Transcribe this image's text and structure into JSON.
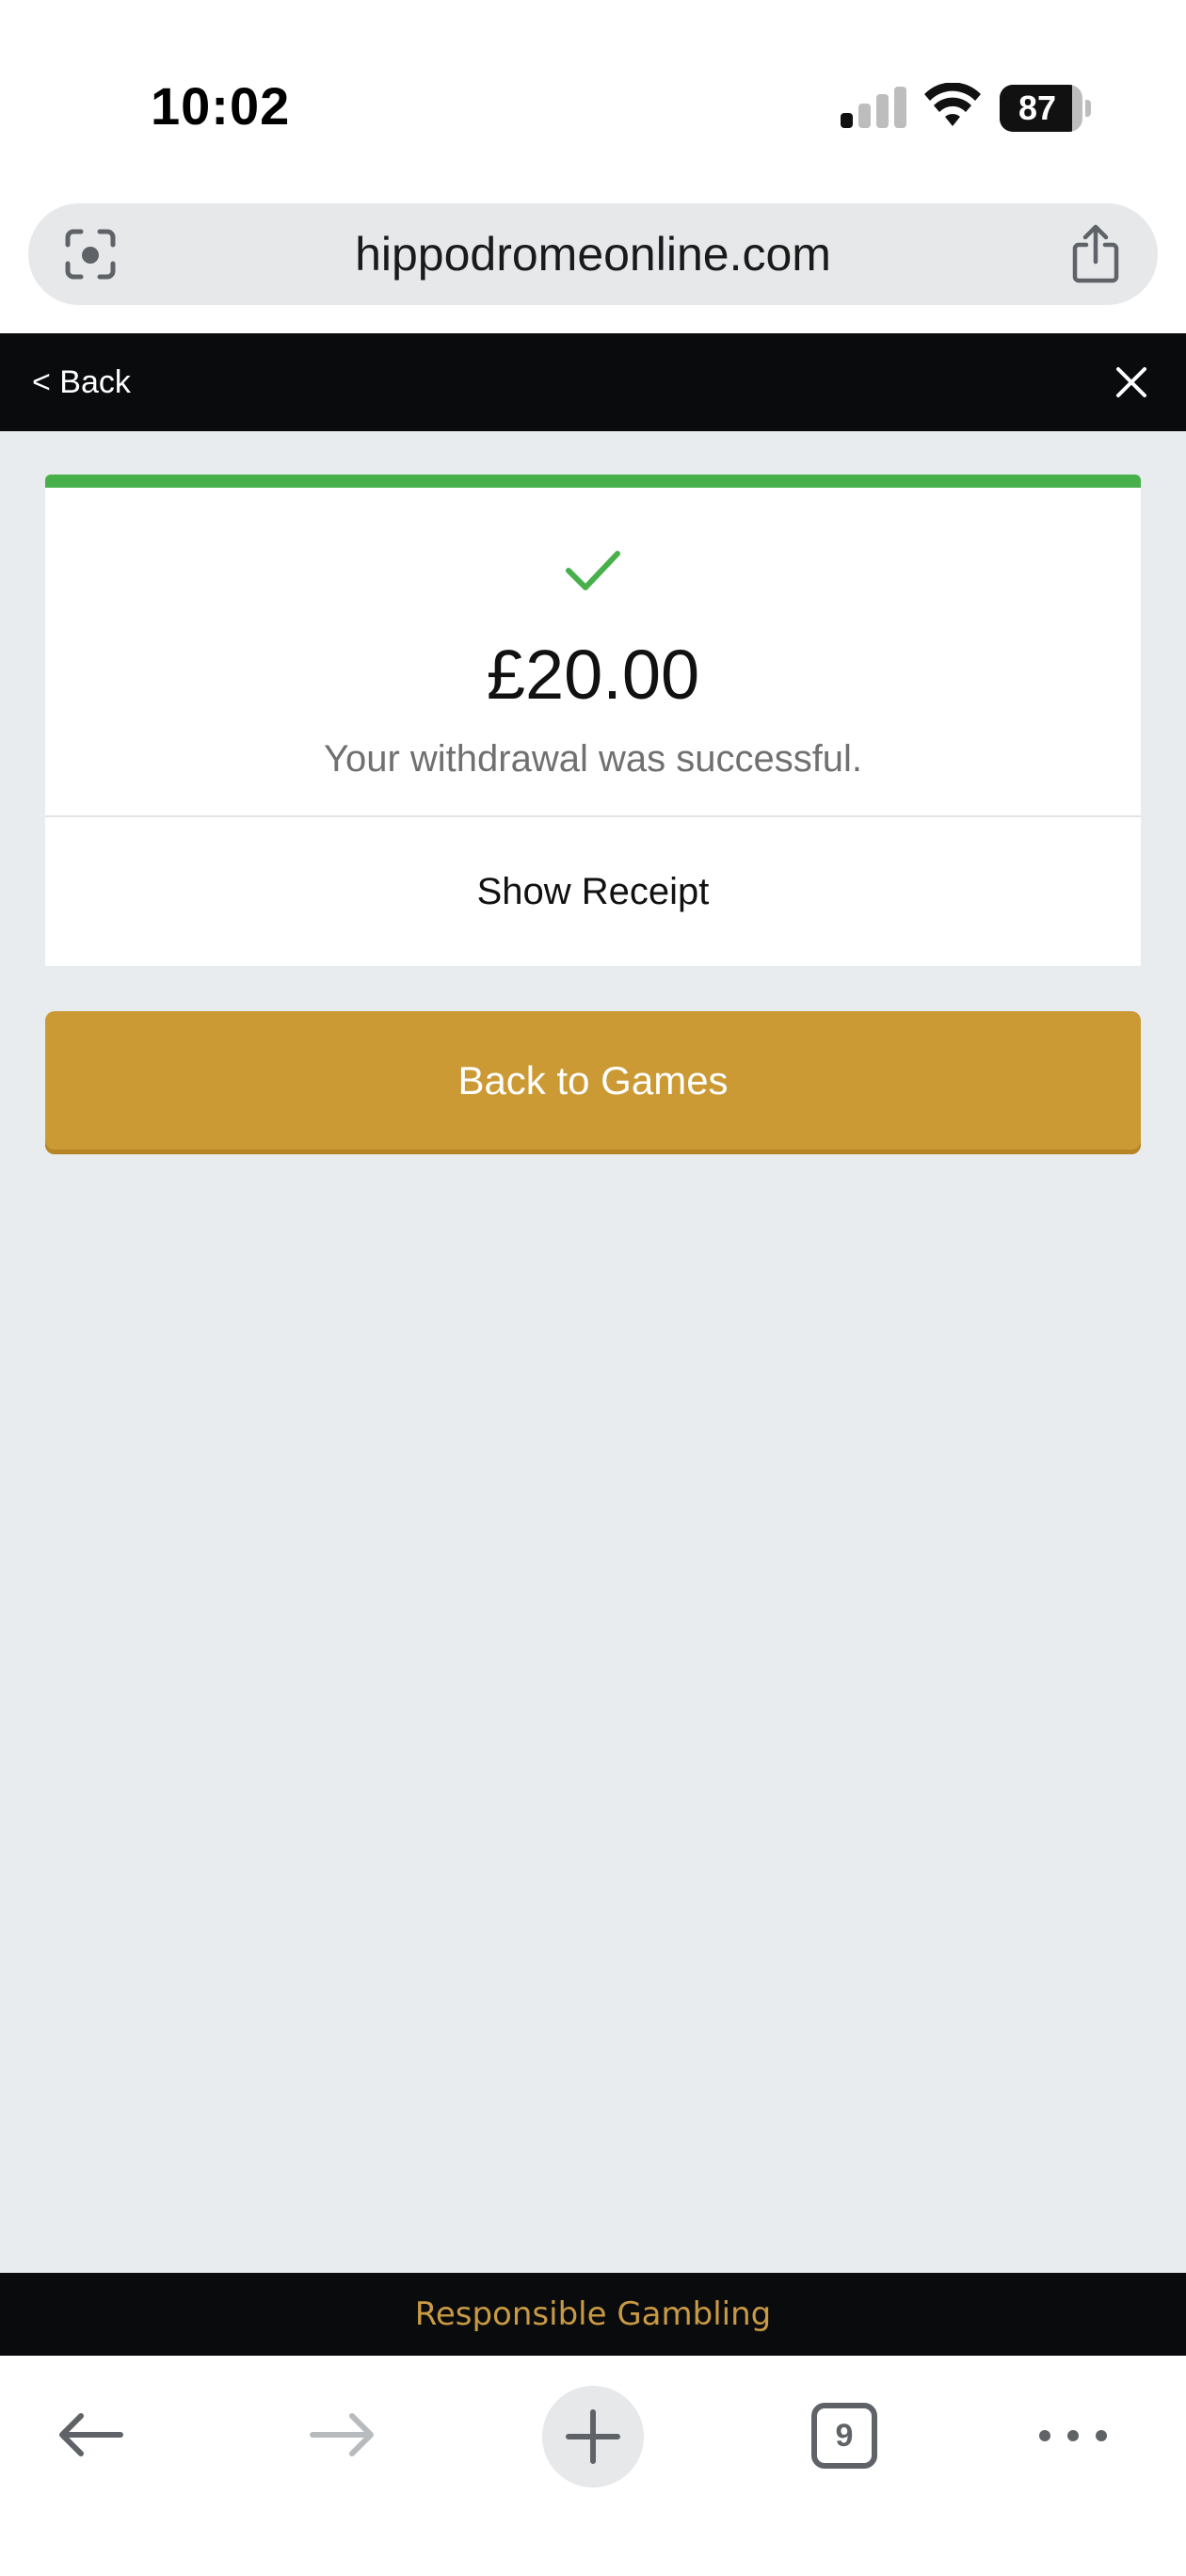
{
  "status_bar": {
    "time": "10:02",
    "battery": "87",
    "battery_level": 0.87
  },
  "browser": {
    "url": "hippodromeonline.com",
    "tab_count": "9"
  },
  "header": {
    "back_label": "< Back"
  },
  "result": {
    "amount": "£20.00",
    "message": "Your withdrawal was successful.",
    "receipt_label": "Show Receipt",
    "status_color": "#47b04b"
  },
  "actions": {
    "back_to_games": "Back to Games",
    "button_color": "#cb9a35"
  },
  "footer": {
    "responsible_gambling": "Responsible Gambling"
  },
  "icons": {
    "lens": "google-lens-icon",
    "share": "share-icon",
    "close": "close-icon",
    "check": "check-icon",
    "back": "arrow-left-icon",
    "forward": "arrow-right-icon",
    "new_tab": "plus-icon",
    "more": "more-dots-icon"
  }
}
